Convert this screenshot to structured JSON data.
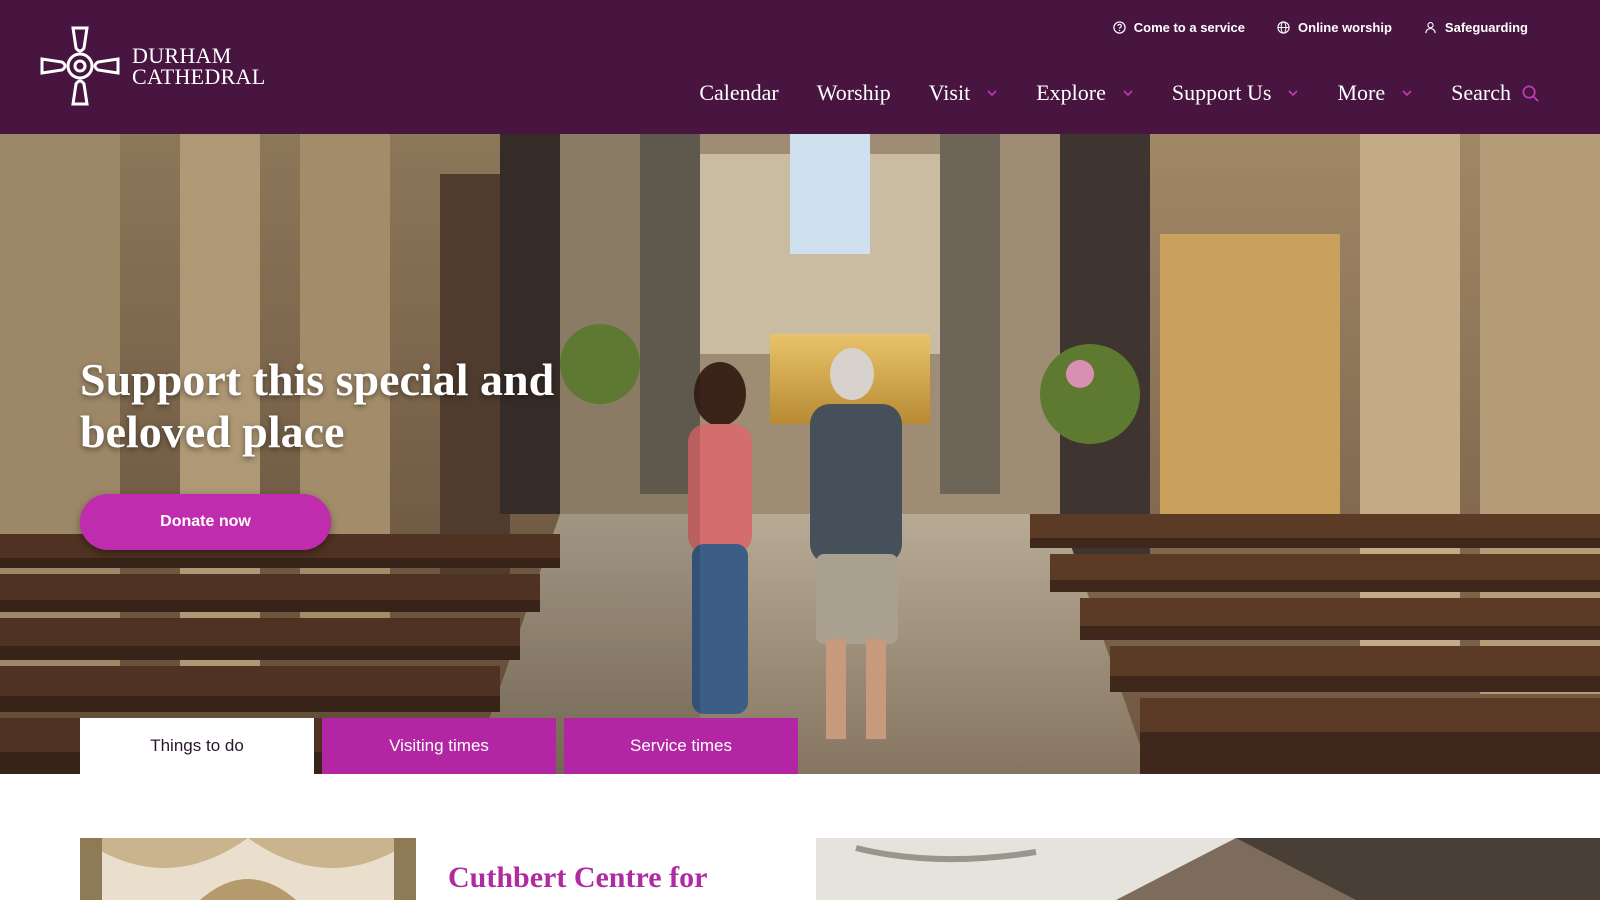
{
  "brand": {
    "line1": "DURHAM",
    "line2": "CATHEDRAL",
    "primary_color": "#481541",
    "accent_color": "#c02cae"
  },
  "utility_nav": [
    {
      "label": "Come to a service",
      "icon": "info-circle-icon"
    },
    {
      "label": "Online worship",
      "icon": "globe-icon"
    },
    {
      "label": "Safeguarding",
      "icon": "person-icon"
    }
  ],
  "main_nav": [
    {
      "label": "Calendar"
    },
    {
      "label": "Worship"
    },
    {
      "label": "Visit",
      "icon": "chevron-down-icon"
    },
    {
      "label": "Explore",
      "icon": "chevron-down-icon"
    },
    {
      "label": "Support Us",
      "icon": "chevron-down-icon"
    },
    {
      "label": "More",
      "icon": "chevron-down-icon"
    },
    {
      "label": "Search",
      "icon": "search-icon"
    }
  ],
  "hero": {
    "title": "Support this special and beloved place",
    "cta": "Donate now"
  },
  "tabs": [
    {
      "label": "Things to do",
      "active": true
    },
    {
      "label": "Visiting times",
      "active": false
    },
    {
      "label": "Service times",
      "active": false
    }
  ],
  "feature": {
    "card_title": "Cuthbert Centre for Pilgrimage and Prayer"
  }
}
